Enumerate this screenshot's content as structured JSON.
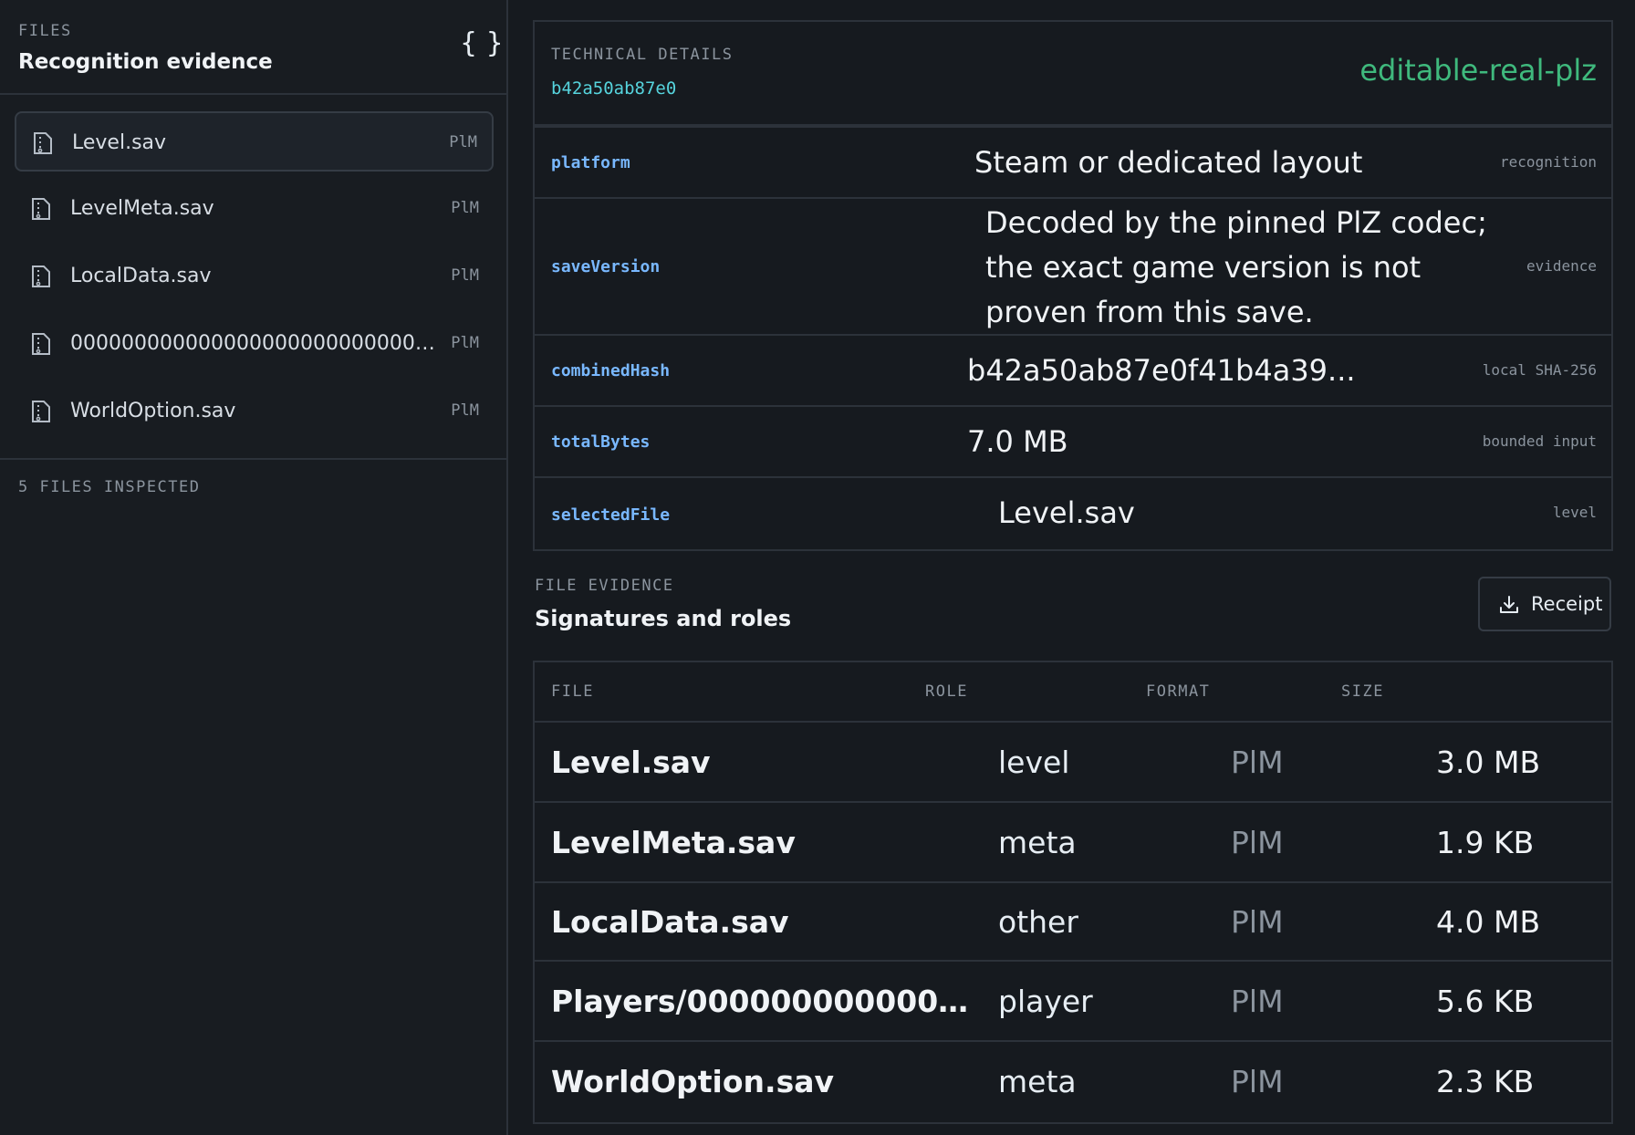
{
  "sidebar": {
    "eyebrow": "FILES",
    "title": "Recognition evidence",
    "toggle_label": "{ }",
    "items": [
      {
        "name": "Level.sav",
        "format": "PlM"
      },
      {
        "name": "LevelMeta.sav",
        "format": "PlM"
      },
      {
        "name": "LocalData.sav",
        "format": "PlM"
      },
      {
        "name": "0000000000000000000000000000...",
        "format": "PlM"
      },
      {
        "name": "WorldOption.sav",
        "format": "PlM"
      }
    ],
    "footer": "5 FILES INSPECTED"
  },
  "technical": {
    "eyebrow": "TECHNICAL DETAILS",
    "hash": "b42a50ab87e0",
    "mode": "editable-real-plz",
    "rows": [
      {
        "key": "platform",
        "value": "Steam or dedicated layout",
        "note": "recognition"
      },
      {
        "key": "saveVersion",
        "value": "Decoded by the pinned PlZ codec; the exact game version is not proven from this save.",
        "note": "evidence"
      },
      {
        "key": "combinedHash",
        "value": "b42a50ab87e0f41b4a39...",
        "note": "local SHA-256"
      },
      {
        "key": "totalBytes",
        "value": "7.0 MB",
        "note": "bounded input"
      },
      {
        "key": "selectedFile",
        "value": "Level.sav",
        "note": "level"
      }
    ]
  },
  "evidence": {
    "eyebrow": "FILE EVIDENCE",
    "title": "Signatures and roles",
    "receipt_label": "Receipt",
    "columns": [
      "FILE",
      "ROLE",
      "FORMAT",
      "SIZE"
    ],
    "rows": [
      {
        "file": "Level.sav",
        "role": "level",
        "format": "PlM",
        "size": "3.0 MB"
      },
      {
        "file": "LevelMeta.sav",
        "role": "meta",
        "format": "PlM",
        "size": "1.9 KB"
      },
      {
        "file": "LocalData.sav",
        "role": "other",
        "format": "PlM",
        "size": "4.0 MB"
      },
      {
        "file": "Players/0000000000000000...",
        "role": "player",
        "format": "PlM",
        "size": "5.6 KB"
      },
      {
        "file": "WorldOption.sav",
        "role": "meta",
        "format": "PlM",
        "size": "2.3 KB"
      }
    ]
  },
  "colors": {
    "background": "#161a1f",
    "accent_hash": "#56d4dd",
    "accent_mode": "#3fb97d",
    "key_blue": "#79b8ff"
  }
}
